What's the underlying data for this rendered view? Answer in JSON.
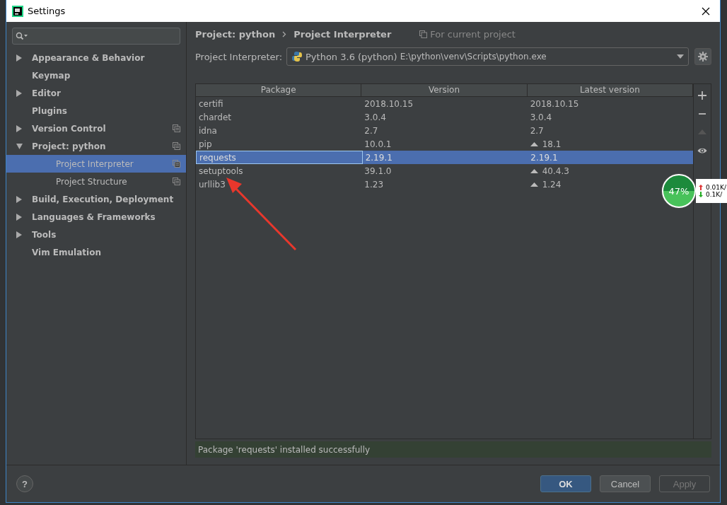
{
  "window": {
    "title": "Settings"
  },
  "sidebar": {
    "items": [
      {
        "label": "Appearance & Behavior",
        "kind": "group",
        "expanded": false,
        "selected": false,
        "project_scoped": false
      },
      {
        "label": "Keymap",
        "kind": "leaf",
        "selected": false,
        "project_scoped": false
      },
      {
        "label": "Editor",
        "kind": "group",
        "expanded": false,
        "selected": false,
        "project_scoped": false
      },
      {
        "label": "Plugins",
        "kind": "leaf",
        "selected": false,
        "project_scoped": false
      },
      {
        "label": "Version Control",
        "kind": "group",
        "expanded": false,
        "selected": false,
        "project_scoped": true
      },
      {
        "label": "Project: python",
        "kind": "group",
        "expanded": true,
        "selected": false,
        "project_scoped": true,
        "children": [
          {
            "label": "Project Interpreter",
            "kind": "leaf",
            "selected": true,
            "project_scoped": true
          },
          {
            "label": "Project Structure",
            "kind": "leaf",
            "selected": false,
            "project_scoped": true
          }
        ]
      },
      {
        "label": "Build, Execution, Deployment",
        "kind": "group",
        "expanded": false,
        "selected": false,
        "project_scoped": false
      },
      {
        "label": "Languages & Frameworks",
        "kind": "group",
        "expanded": false,
        "selected": false,
        "project_scoped": false
      },
      {
        "label": "Tools",
        "kind": "group",
        "expanded": false,
        "selected": false,
        "project_scoped": false
      },
      {
        "label": "Vim Emulation",
        "kind": "leaf",
        "selected": false,
        "project_scoped": false
      }
    ]
  },
  "breadcrumb": [
    "Project: python",
    "Project Interpreter"
  ],
  "scope_note": "For current project",
  "interpreter": {
    "label": "Project Interpreter:",
    "name": "Python 3.6 (python)",
    "path": "E:\\python\\venv\\Scripts\\python.exe"
  },
  "table": {
    "columns": [
      "Package",
      "Version",
      "Latest version"
    ],
    "rows": [
      {
        "package": "certifi",
        "version": "2018.10.15",
        "latest": "2018.10.15",
        "upgrade": false,
        "selected": false
      },
      {
        "package": "chardet",
        "version": "3.0.4",
        "latest": "3.0.4",
        "upgrade": false,
        "selected": false
      },
      {
        "package": "idna",
        "version": "2.7",
        "latest": "2.7",
        "upgrade": false,
        "selected": false
      },
      {
        "package": "pip",
        "version": "10.0.1",
        "latest": "18.1",
        "upgrade": true,
        "selected": false
      },
      {
        "package": "requests",
        "version": "2.19.1",
        "latest": "2.19.1",
        "upgrade": false,
        "selected": true
      },
      {
        "package": "setuptools",
        "version": "39.1.0",
        "latest": "40.4.3",
        "upgrade": true,
        "selected": false
      },
      {
        "package": "urllib3",
        "version": "1.23",
        "latest": "1.24",
        "upgrade": true,
        "selected": false
      }
    ]
  },
  "toolbar": [
    {
      "kind": "add",
      "disabled": false
    },
    {
      "kind": "remove",
      "disabled": false
    },
    {
      "kind": "upgrade",
      "disabled": true
    },
    {
      "kind": "show",
      "disabled": false
    }
  ],
  "status": "Package 'requests' installed successfully",
  "help": "?",
  "buttons": [
    {
      "label": "OK",
      "default": true,
      "disabled": false
    },
    {
      "label": "Cancel",
      "default": false,
      "disabled": false
    },
    {
      "label": "Apply",
      "default": false,
      "disabled": true
    }
  ],
  "network_widget": {
    "percent": "47%",
    "upload": "0.01K/",
    "download": "0.1K/"
  }
}
